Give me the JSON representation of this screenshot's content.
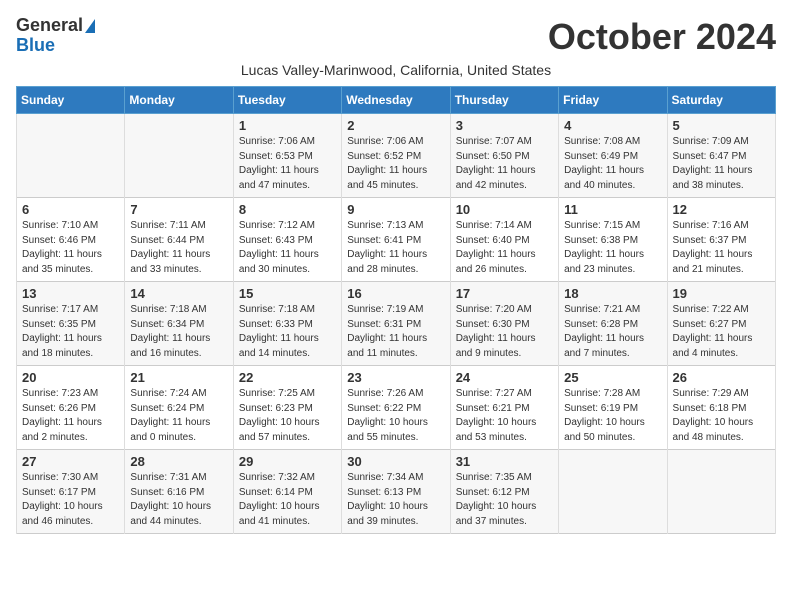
{
  "logo": {
    "line1": "General",
    "line2": "Blue"
  },
  "title": "October 2024",
  "subtitle": "Lucas Valley-Marinwood, California, United States",
  "days_of_week": [
    "Sunday",
    "Monday",
    "Tuesday",
    "Wednesday",
    "Thursday",
    "Friday",
    "Saturday"
  ],
  "weeks": [
    [
      {
        "day": "",
        "sunrise": "",
        "sunset": "",
        "daylight": ""
      },
      {
        "day": "",
        "sunrise": "",
        "sunset": "",
        "daylight": ""
      },
      {
        "day": "1",
        "sunrise": "Sunrise: 7:06 AM",
        "sunset": "Sunset: 6:53 PM",
        "daylight": "Daylight: 11 hours and 47 minutes."
      },
      {
        "day": "2",
        "sunrise": "Sunrise: 7:06 AM",
        "sunset": "Sunset: 6:52 PM",
        "daylight": "Daylight: 11 hours and 45 minutes."
      },
      {
        "day": "3",
        "sunrise": "Sunrise: 7:07 AM",
        "sunset": "Sunset: 6:50 PM",
        "daylight": "Daylight: 11 hours and 42 minutes."
      },
      {
        "day": "4",
        "sunrise": "Sunrise: 7:08 AM",
        "sunset": "Sunset: 6:49 PM",
        "daylight": "Daylight: 11 hours and 40 minutes."
      },
      {
        "day": "5",
        "sunrise": "Sunrise: 7:09 AM",
        "sunset": "Sunset: 6:47 PM",
        "daylight": "Daylight: 11 hours and 38 minutes."
      }
    ],
    [
      {
        "day": "6",
        "sunrise": "Sunrise: 7:10 AM",
        "sunset": "Sunset: 6:46 PM",
        "daylight": "Daylight: 11 hours and 35 minutes."
      },
      {
        "day": "7",
        "sunrise": "Sunrise: 7:11 AM",
        "sunset": "Sunset: 6:44 PM",
        "daylight": "Daylight: 11 hours and 33 minutes."
      },
      {
        "day": "8",
        "sunrise": "Sunrise: 7:12 AM",
        "sunset": "Sunset: 6:43 PM",
        "daylight": "Daylight: 11 hours and 30 minutes."
      },
      {
        "day": "9",
        "sunrise": "Sunrise: 7:13 AM",
        "sunset": "Sunset: 6:41 PM",
        "daylight": "Daylight: 11 hours and 28 minutes."
      },
      {
        "day": "10",
        "sunrise": "Sunrise: 7:14 AM",
        "sunset": "Sunset: 6:40 PM",
        "daylight": "Daylight: 11 hours and 26 minutes."
      },
      {
        "day": "11",
        "sunrise": "Sunrise: 7:15 AM",
        "sunset": "Sunset: 6:38 PM",
        "daylight": "Daylight: 11 hours and 23 minutes."
      },
      {
        "day": "12",
        "sunrise": "Sunrise: 7:16 AM",
        "sunset": "Sunset: 6:37 PM",
        "daylight": "Daylight: 11 hours and 21 minutes."
      }
    ],
    [
      {
        "day": "13",
        "sunrise": "Sunrise: 7:17 AM",
        "sunset": "Sunset: 6:35 PM",
        "daylight": "Daylight: 11 hours and 18 minutes."
      },
      {
        "day": "14",
        "sunrise": "Sunrise: 7:18 AM",
        "sunset": "Sunset: 6:34 PM",
        "daylight": "Daylight: 11 hours and 16 minutes."
      },
      {
        "day": "15",
        "sunrise": "Sunrise: 7:18 AM",
        "sunset": "Sunset: 6:33 PM",
        "daylight": "Daylight: 11 hours and 14 minutes."
      },
      {
        "day": "16",
        "sunrise": "Sunrise: 7:19 AM",
        "sunset": "Sunset: 6:31 PM",
        "daylight": "Daylight: 11 hours and 11 minutes."
      },
      {
        "day": "17",
        "sunrise": "Sunrise: 7:20 AM",
        "sunset": "Sunset: 6:30 PM",
        "daylight": "Daylight: 11 hours and 9 minutes."
      },
      {
        "day": "18",
        "sunrise": "Sunrise: 7:21 AM",
        "sunset": "Sunset: 6:28 PM",
        "daylight": "Daylight: 11 hours and 7 minutes."
      },
      {
        "day": "19",
        "sunrise": "Sunrise: 7:22 AM",
        "sunset": "Sunset: 6:27 PM",
        "daylight": "Daylight: 11 hours and 4 minutes."
      }
    ],
    [
      {
        "day": "20",
        "sunrise": "Sunrise: 7:23 AM",
        "sunset": "Sunset: 6:26 PM",
        "daylight": "Daylight: 11 hours and 2 minutes."
      },
      {
        "day": "21",
        "sunrise": "Sunrise: 7:24 AM",
        "sunset": "Sunset: 6:24 PM",
        "daylight": "Daylight: 11 hours and 0 minutes."
      },
      {
        "day": "22",
        "sunrise": "Sunrise: 7:25 AM",
        "sunset": "Sunset: 6:23 PM",
        "daylight": "Daylight: 10 hours and 57 minutes."
      },
      {
        "day": "23",
        "sunrise": "Sunrise: 7:26 AM",
        "sunset": "Sunset: 6:22 PM",
        "daylight": "Daylight: 10 hours and 55 minutes."
      },
      {
        "day": "24",
        "sunrise": "Sunrise: 7:27 AM",
        "sunset": "Sunset: 6:21 PM",
        "daylight": "Daylight: 10 hours and 53 minutes."
      },
      {
        "day": "25",
        "sunrise": "Sunrise: 7:28 AM",
        "sunset": "Sunset: 6:19 PM",
        "daylight": "Daylight: 10 hours and 50 minutes."
      },
      {
        "day": "26",
        "sunrise": "Sunrise: 7:29 AM",
        "sunset": "Sunset: 6:18 PM",
        "daylight": "Daylight: 10 hours and 48 minutes."
      }
    ],
    [
      {
        "day": "27",
        "sunrise": "Sunrise: 7:30 AM",
        "sunset": "Sunset: 6:17 PM",
        "daylight": "Daylight: 10 hours and 46 minutes."
      },
      {
        "day": "28",
        "sunrise": "Sunrise: 7:31 AM",
        "sunset": "Sunset: 6:16 PM",
        "daylight": "Daylight: 10 hours and 44 minutes."
      },
      {
        "day": "29",
        "sunrise": "Sunrise: 7:32 AM",
        "sunset": "Sunset: 6:14 PM",
        "daylight": "Daylight: 10 hours and 41 minutes."
      },
      {
        "day": "30",
        "sunrise": "Sunrise: 7:34 AM",
        "sunset": "Sunset: 6:13 PM",
        "daylight": "Daylight: 10 hours and 39 minutes."
      },
      {
        "day": "31",
        "sunrise": "Sunrise: 7:35 AM",
        "sunset": "Sunset: 6:12 PM",
        "daylight": "Daylight: 10 hours and 37 minutes."
      },
      {
        "day": "",
        "sunrise": "",
        "sunset": "",
        "daylight": ""
      },
      {
        "day": "",
        "sunrise": "",
        "sunset": "",
        "daylight": ""
      }
    ]
  ]
}
